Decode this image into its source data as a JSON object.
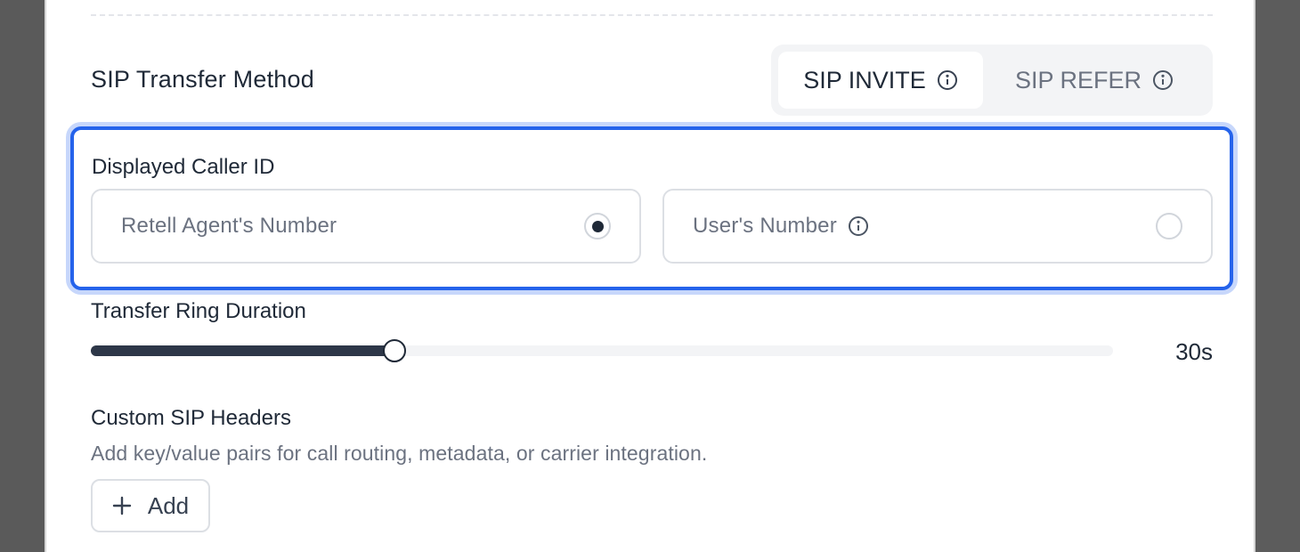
{
  "transfer_method": {
    "title": "SIP Transfer Method",
    "options": [
      {
        "label": "SIP INVITE",
        "active": true
      },
      {
        "label": "SIP REFER",
        "active": false
      }
    ]
  },
  "caller_id": {
    "label": "Displayed Caller ID",
    "options": [
      {
        "label": "Retell Agent's Number",
        "selected": true
      },
      {
        "label": "User's Number",
        "selected": false
      }
    ]
  },
  "ring_duration": {
    "label": "Transfer Ring Duration",
    "value_text": "30s",
    "fraction": 0.297
  },
  "custom_headers": {
    "label": "Custom SIP Headers",
    "description": "Add key/value pairs for call routing, metadata, or carrier integration.",
    "add_label": "Add"
  },
  "colors": {
    "accent": "#2563eb",
    "slider_fill": "#2d3748"
  },
  "icons": {
    "info": "info-circle-icon",
    "plus": "plus-icon"
  }
}
